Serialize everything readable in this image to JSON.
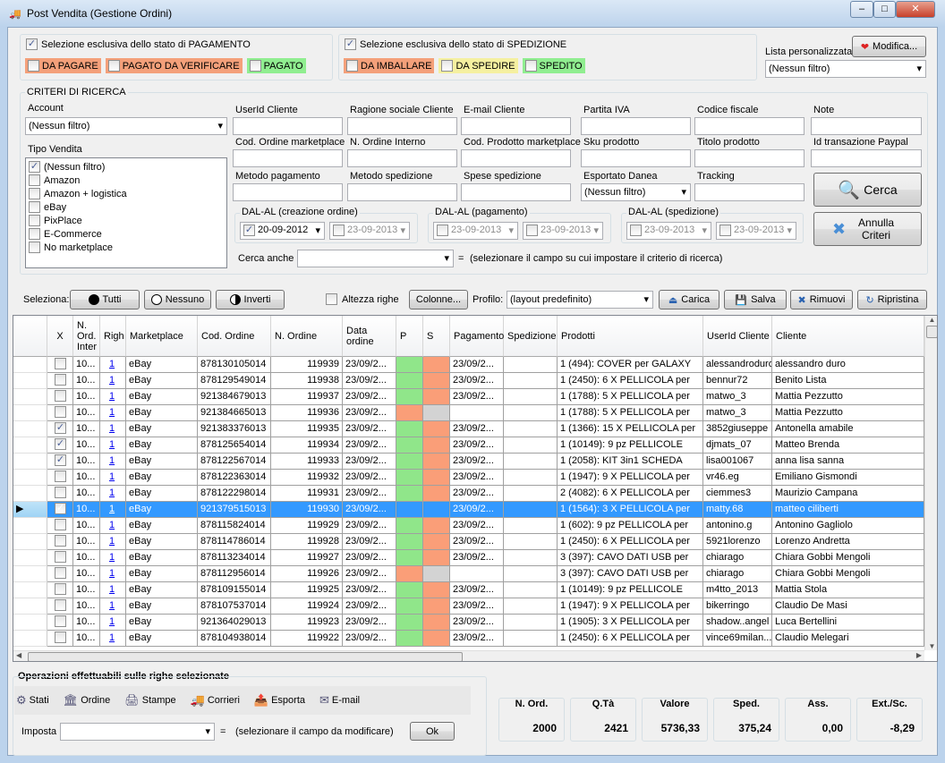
{
  "window": {
    "title": "Post Vendita (Gestione Ordini)",
    "minimize": "–",
    "maximize": "□",
    "close": "✕"
  },
  "payment": {
    "label": "Selezione esclusiva dello stato di PAGAMENTO",
    "checked": true,
    "states": [
      {
        "label": "DA PAGARE",
        "color": "#f4a07a"
      },
      {
        "label": "PAGATO DA VERIFICARE",
        "color": "#f4a07a"
      },
      {
        "label": "PAGATO",
        "color": "#90ee90"
      }
    ]
  },
  "shipping": {
    "label": "Selezione esclusiva dello stato di SPEDIZIONE",
    "checked": true,
    "states": [
      {
        "label": "DA IMBALLARE",
        "color": "#f4a07a"
      },
      {
        "label": "DA SPEDIRE",
        "color": "#f5f0a0"
      },
      {
        "label": "SPEDITO",
        "color": "#90ee90"
      }
    ]
  },
  "custom_list": {
    "label": "Lista personalizzata",
    "button": "Modifica...",
    "value": "(Nessun filtro)"
  },
  "criteria": {
    "title": "CRITERI DI RICERCA",
    "account_label": "Account",
    "account_value": "(Nessun filtro)",
    "tipo_label": "Tipo Vendita",
    "tipo_items": [
      {
        "label": "(Nessun filtro)",
        "checked": true
      },
      {
        "label": "Amazon",
        "checked": false
      },
      {
        "label": "Amazon + logistica",
        "checked": false
      },
      {
        "label": "eBay",
        "checked": false
      },
      {
        "label": "PixPlace",
        "checked": false
      },
      {
        "label": "E-Commerce",
        "checked": false
      },
      {
        "label": "No marketplace",
        "checked": false
      }
    ],
    "fields_row1": [
      "UserId Cliente",
      "Ragione sociale Cliente",
      "E-mail Cliente",
      "Partita IVA",
      "Codice fiscale",
      "Note"
    ],
    "fields_row2": [
      "Cod. Ordine marketplace",
      "N. Ordine Interno",
      "Cod. Prodotto marketplace",
      "Sku prodotto",
      "Titolo prodotto",
      "Id transazione Paypal"
    ],
    "fields_row3": [
      "Metodo pagamento",
      "Metodo spedizione",
      "Spese spedizione",
      "Esportato Danea",
      "Tracking"
    ],
    "esportato_value": "(Nessun filtro)",
    "search_button": "Cerca",
    "cancel_button": "Annulla Criteri",
    "date_creation": {
      "label": "DAL-AL (creazione ordine)",
      "from": "20-09-2012",
      "from_checked": true,
      "to": "23-09-2013"
    },
    "date_payment": {
      "label": "DAL-AL (pagamento)",
      "from": "23-09-2013",
      "to": "23-09-2013"
    },
    "date_shipping": {
      "label": "DAL-AL (spedizione)",
      "from": "23-09-2013",
      "to": "23-09-2013"
    },
    "cerca_anche_label": "Cerca anche",
    "cerca_anche_hint": "(selezionare il campo su cui impostare il criterio di ricerca)",
    "equals": "="
  },
  "toolbar": {
    "seleziona": "Seleziona:",
    "tutti": "Tutti",
    "nessuno": "Nessuno",
    "inverti": "Inverti",
    "altezza": "Altezza righe",
    "colonne": "Colonne...",
    "profilo": "Profilo:",
    "profilo_value": "(layout predefinito)",
    "carica": "Carica",
    "salva": "Salva",
    "rimuovi": "Rimuovi",
    "ripristina": "Ripristina"
  },
  "grid": {
    "columns": [
      "X",
      "N. Ord. Inter",
      "Righ",
      "Marketplace",
      "Cod. Ordine",
      "N. Ordine",
      "Data ordine",
      "P",
      "S",
      "Pagamento",
      "Spedizione",
      "Prodotti",
      "UserId Cliente",
      "Cliente"
    ],
    "selected_row": 9,
    "rows": [
      [
        "0",
        "10...",
        "1",
        "eBay",
        "878130105014",
        "119939",
        "23/09/2...",
        "green",
        "orange",
        "23/09/2...",
        "",
        "1 (494): COVER per GALAXY",
        "alessandroduro",
        "alessandro duro"
      ],
      [
        "0",
        "10...",
        "1",
        "eBay",
        "878129549014",
        "119938",
        "23/09/2...",
        "green",
        "orange",
        "23/09/2...",
        "",
        "1 (2450): 6 X PELLICOLA per",
        "bennur72",
        "Benito Lista"
      ],
      [
        "0",
        "10...",
        "1",
        "eBay",
        "921384679013",
        "119937",
        "23/09/2...",
        "green",
        "orange",
        "23/09/2...",
        "",
        "1 (1788): 5 X PELLICOLA per",
        "matwo_3",
        "Mattia Pezzutto"
      ],
      [
        "0",
        "10...",
        "1",
        "eBay",
        "921384665013",
        "119936",
        "23/09/2...",
        "orange",
        "gray",
        "",
        "",
        "1 (1788): 5 X PELLICOLA per",
        "matwo_3",
        "Mattia Pezzutto"
      ],
      [
        "1",
        "10...",
        "1",
        "eBay",
        "921383376013",
        "119935",
        "23/09/2...",
        "green",
        "orange",
        "23/09/2...",
        "",
        "1 (1366): 15 X PELLICOLA per",
        "3852giuseppe",
        "Antonella amabile"
      ],
      [
        "1",
        "10...",
        "1",
        "eBay",
        "878125654014",
        "119934",
        "23/09/2...",
        "green",
        "orange",
        "23/09/2...",
        "",
        "1 (10149): 9 pz PELLICOLE",
        "djmats_07",
        "Matteo Brenda"
      ],
      [
        "1",
        "10...",
        "1",
        "eBay",
        "878122567014",
        "119933",
        "23/09/2...",
        "green",
        "orange",
        "23/09/2...",
        "",
        "1 (2058): KIT 3in1 SCHEDA",
        "lisa001067",
        "anna lisa sanna"
      ],
      [
        "0",
        "10...",
        "1",
        "eBay",
        "878122363014",
        "119932",
        "23/09/2...",
        "green",
        "orange",
        "23/09/2...",
        "",
        "1 (1947): 9 X PELLICOLA per",
        "vr46.eg",
        "Emiliano Gismondi"
      ],
      [
        "0",
        "10...",
        "1",
        "eBay",
        "878122298014",
        "119931",
        "23/09/2...",
        "green",
        "orange",
        "23/09/2...",
        "",
        "2 (4082): 6 X PELLICOLA per",
        "ciemmes3",
        "Maurizio Campana"
      ],
      [
        "1",
        "10...",
        "1",
        "eBay",
        "921379515013",
        "119930",
        "23/09/2...",
        "green",
        "orange",
        "23/09/2...",
        "",
        "1 (1564): 3 X PELLICOLA per",
        "matty.68",
        "matteo ciliberti"
      ],
      [
        "0",
        "10...",
        "1",
        "eBay",
        "878115824014",
        "119929",
        "23/09/2...",
        "green",
        "orange",
        "23/09/2...",
        "",
        "1 (602): 9 pz PELLICOLA per",
        "antonino.g",
        "Antonino Gagliolo"
      ],
      [
        "0",
        "10...",
        "1",
        "eBay",
        "878114786014",
        "119928",
        "23/09/2...",
        "green",
        "orange",
        "23/09/2...",
        "",
        "1 (2450): 6 X PELLICOLA per",
        "5921lorenzo",
        "Lorenzo Andretta"
      ],
      [
        "0",
        "10...",
        "1",
        "eBay",
        "878113234014",
        "119927",
        "23/09/2...",
        "green",
        "orange",
        "23/09/2...",
        "",
        "3 (397): CAVO DATI USB per",
        "chiarago",
        "Chiara Gobbi Mengoli"
      ],
      [
        "0",
        "10...",
        "1",
        "eBay",
        "878112956014",
        "119926",
        "23/09/2...",
        "orange",
        "gray",
        "",
        "",
        "3 (397): CAVO DATI USB per",
        "chiarago",
        "Chiara Gobbi Mengoli"
      ],
      [
        "0",
        "10...",
        "1",
        "eBay",
        "878109155014",
        "119925",
        "23/09/2...",
        "green",
        "orange",
        "23/09/2...",
        "",
        "1 (10149): 9 pz PELLICOLE",
        "m4tto_2013",
        "Mattia Stola"
      ],
      [
        "0",
        "10...",
        "1",
        "eBay",
        "878107537014",
        "119924",
        "23/09/2...",
        "green",
        "orange",
        "23/09/2...",
        "",
        "1 (1947): 9 X PELLICOLA per",
        "bikerringo",
        "Claudio De Masi"
      ],
      [
        "0",
        "10...",
        "1",
        "eBay",
        "921364029013",
        "119923",
        "23/09/2...",
        "green",
        "orange",
        "23/09/2...",
        "",
        "1 (1905): 3 X PELLICOLA per",
        "shadow..angel",
        "Luca Bertellini"
      ],
      [
        "0",
        "10...",
        "1",
        "eBay",
        "878104938014",
        "119922",
        "23/09/2...",
        "green",
        "orange",
        "23/09/2...",
        "",
        "1 (2450): 6 X PELLICOLA per",
        "vince69milan...",
        "Claudio Melegari"
      ]
    ],
    "status_colors": {
      "green": "#90e68a",
      "orange": "#fa9e78",
      "gray": "#d3d3d3"
    }
  },
  "operations": {
    "title": "Operazioni effettuabili sulle righe selezionate",
    "items": [
      "Stati",
      "Ordine",
      "Stampe",
      "Corrieri",
      "Esporta",
      "E-mail"
    ],
    "imposta_label": "Imposta",
    "equals": "=",
    "hint": "(selezionare il campo da modificare)",
    "ok": "Ok"
  },
  "totals": [
    {
      "label": "N. Ord.",
      "value": "2000"
    },
    {
      "label": "Q.Tà",
      "value": "2421"
    },
    {
      "label": "Valore",
      "value": "5736,33"
    },
    {
      "label": "Sped.",
      "value": "375,24"
    },
    {
      "label": "Ass.",
      "value": "0,00"
    },
    {
      "label": "Ext./Sc.",
      "value": "-8,29"
    }
  ]
}
